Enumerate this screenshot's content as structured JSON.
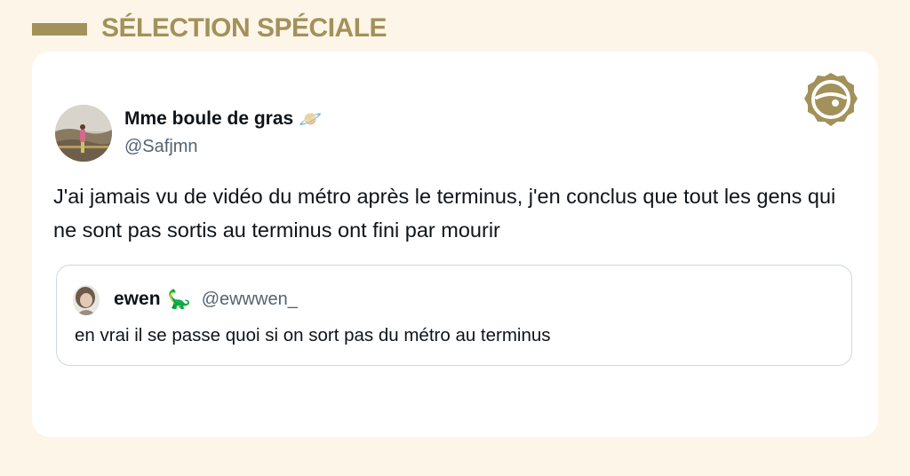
{
  "header": {
    "title": "SÉLECTION SPÉCIALE"
  },
  "colors": {
    "accent": "#a3915a",
    "background": "#fdf6e8",
    "card": "#ffffff",
    "text": "#0f1419",
    "muted": "#536471",
    "border": "#cfd9de"
  },
  "tweet": {
    "display_name": "Mme boule de gras",
    "name_emoji": "🪐",
    "handle": "@Safjmn",
    "text": "J'ai jamais vu de vidéo du métro après le terminus, j'en conclus que tout les gens qui ne sont pas sortis au terminus ont fini par mourir"
  },
  "quote": {
    "display_name": "ewen",
    "name_emoji": "🦕",
    "handle": "@ewwwen_",
    "text": "en vrai il se passe quoi si on sort pas du métro au terminus"
  },
  "icons": {
    "brand": "brand-logo-icon",
    "avatar": "user-avatar",
    "quote_avatar": "quote-user-avatar"
  }
}
